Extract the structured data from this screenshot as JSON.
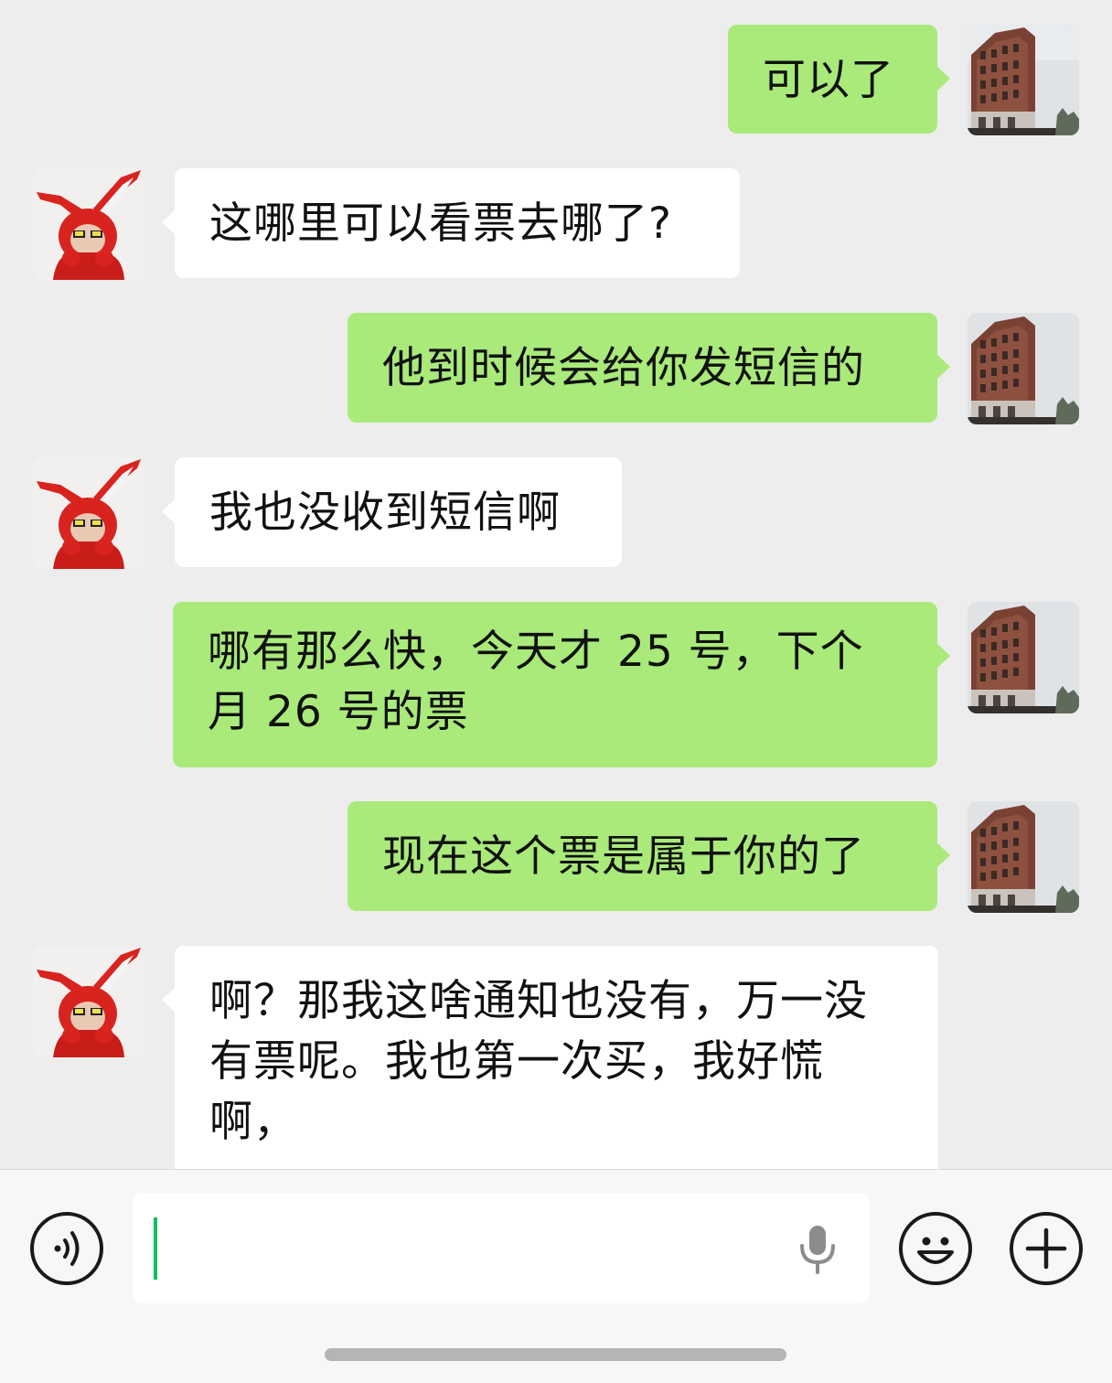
{
  "conversation": {
    "messages": [
      {
        "direction": "sent",
        "sender": "me",
        "text": "可以了"
      },
      {
        "direction": "received",
        "sender": "contact",
        "text": "这哪里可以看票去哪了?"
      },
      {
        "direction": "sent",
        "sender": "me",
        "text": "他到时候会给你发短信的"
      },
      {
        "direction": "received",
        "sender": "contact",
        "text": "我也没收到短信啊"
      },
      {
        "direction": "sent",
        "sender": "me",
        "text": "哪有那么快，今天才 25 号，下个月 26 号的票"
      },
      {
        "direction": "sent",
        "sender": "me",
        "text": "现在这个票是属于你的了"
      },
      {
        "direction": "received",
        "sender": "contact",
        "text": "啊？那我这啥通知也没有，万一没有票呢。我也第一次买，我好慌啊，"
      }
    ]
  },
  "avatars": {
    "me": "building-photo-avatar",
    "contact": "red-bunny-hood-avatar"
  },
  "input_bar": {
    "voice_toggle_icon": "voice-waves-icon",
    "message_text": "",
    "mic_icon": "microphone-icon",
    "emoji_icon": "smiley-face-icon",
    "more_icon": "plus-icon"
  },
  "colors": {
    "chat_background": "#ededed",
    "sent_bubble": "#a9ea7a",
    "received_bubble": "#ffffff",
    "input_bar_background": "#f7f7f7",
    "cursor": "#07c160"
  }
}
